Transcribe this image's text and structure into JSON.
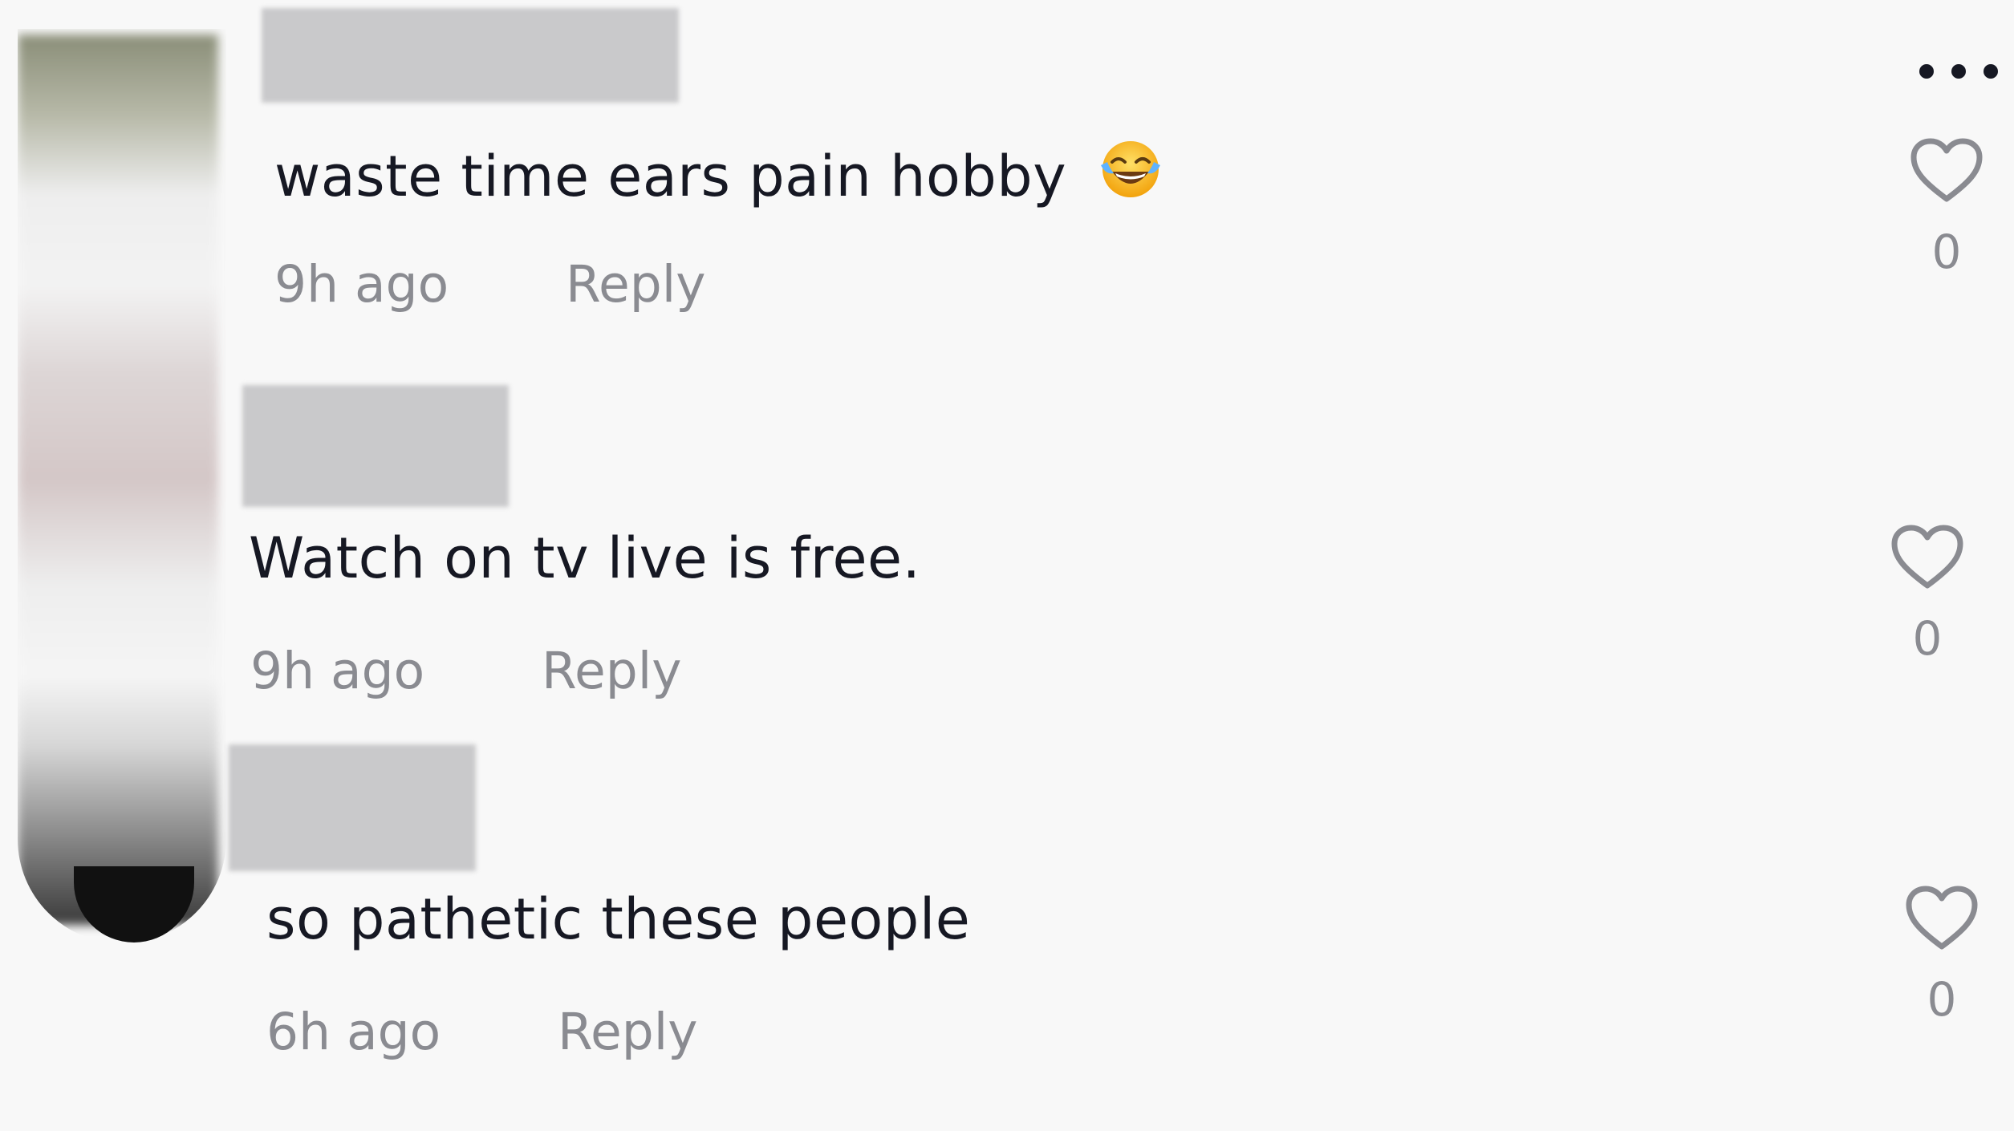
{
  "comments": [
    {
      "text": "waste time ears pain hobby",
      "emoji": "😂",
      "time": "9h ago",
      "reply": "Reply",
      "likes": "0"
    },
    {
      "text": "Watch on tv live is free.",
      "time": "9h ago",
      "reply": "Reply",
      "likes": "0"
    },
    {
      "text": "so pathetic these people",
      "time": "6h ago",
      "reply": "Reply",
      "likes": "0"
    }
  ],
  "icons": {
    "like": "heart-outline-icon",
    "more": "more-horizontal-icon"
  },
  "colors": {
    "background": "#f8f8f8",
    "text": "#161823",
    "muted": "#8a8b91"
  }
}
